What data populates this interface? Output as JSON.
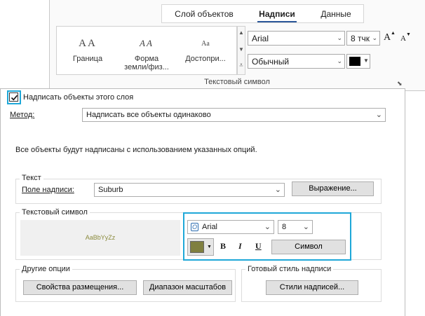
{
  "ribbon": {
    "tabs": [
      {
        "label": "Слой объектов"
      },
      {
        "label": "Надписи"
      },
      {
        "label": "Данные"
      }
    ],
    "gallery": [
      {
        "sample": "AA",
        "label": "Граница"
      },
      {
        "sample": "AA",
        "label": "Форма земли/физ..."
      },
      {
        "sample": "Aa",
        "label": "Достопри..."
      }
    ],
    "font_name": "Arial",
    "font_size": "8 тчк",
    "font_style": "Обычный",
    "grow_font": "A",
    "shrink_font": "A",
    "font_color": "#000000",
    "caption": "Текстовый символ"
  },
  "dialog": {
    "label_checkbox": {
      "label": "Надписать объекты этого слоя",
      "checked": true
    },
    "method": {
      "label": "Метод:",
      "value": "Надписать все объекты одинаково"
    },
    "info_text": "Все объекты будут надписаны с использованием указанных опций.",
    "text_group": {
      "title": "Текст",
      "field_label": "Поле надписи:",
      "field_value": "Suburb",
      "expression_button": "Выражение..."
    },
    "symbol_group": {
      "title": "Текстовый символ",
      "preview_text": "AaBbYyZz",
      "preview_color": "#8a8a3c",
      "font": "Arial",
      "size": "8",
      "color": "#7f7f3f",
      "bold": "B",
      "italic": "I",
      "underline": "U",
      "symbol_button": "Символ"
    },
    "other_group": {
      "title": "Другие опции",
      "placement_button": "Свойства размещения...",
      "scale_button": "Диапазон масштабов"
    },
    "style_group": {
      "title": "Готовый стиль надписи",
      "styles_button": "Стили надписей..."
    }
  }
}
